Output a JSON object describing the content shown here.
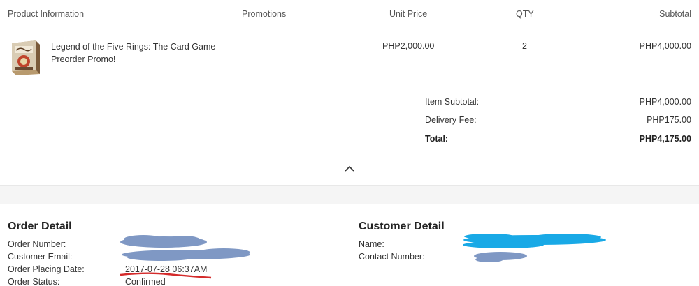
{
  "table": {
    "headers": {
      "product": "Product Information",
      "promotions": "Promotions",
      "unit_price": "Unit Price",
      "qty": "QTY",
      "subtotal": "Subtotal"
    },
    "items": [
      {
        "name": "Legend of the Five Rings: The Card Game Preorder Promo!",
        "unit_price": "PHP2,000.00",
        "qty": "2",
        "subtotal": "PHP4,000.00"
      }
    ]
  },
  "summary": {
    "item_subtotal_label": "Item Subtotal:",
    "item_subtotal_value": "PHP4,000.00",
    "delivery_label": "Delivery Fee:",
    "delivery_value": "PHP175.00",
    "total_label": "Total:",
    "total_value": "PHP4,175.00"
  },
  "toggle": {
    "icon": "chevron-up-icon"
  },
  "order_detail": {
    "title": "Order Detail",
    "number_label": "Order Number:",
    "email_label": "Customer Email:",
    "date_label": "Order Placing Date:",
    "date_value": "2017-07-28 06:37AM",
    "status_label": "Order Status:",
    "status_value": "Confirmed"
  },
  "customer_detail": {
    "title": "Customer Detail",
    "name_label": "Name:",
    "contact_label": "Contact Number:"
  },
  "colors": {
    "redaction_gray_blue": "#7f98c4",
    "redaction_cyan": "#19a9e6",
    "underline_red": "#d42a2a"
  }
}
